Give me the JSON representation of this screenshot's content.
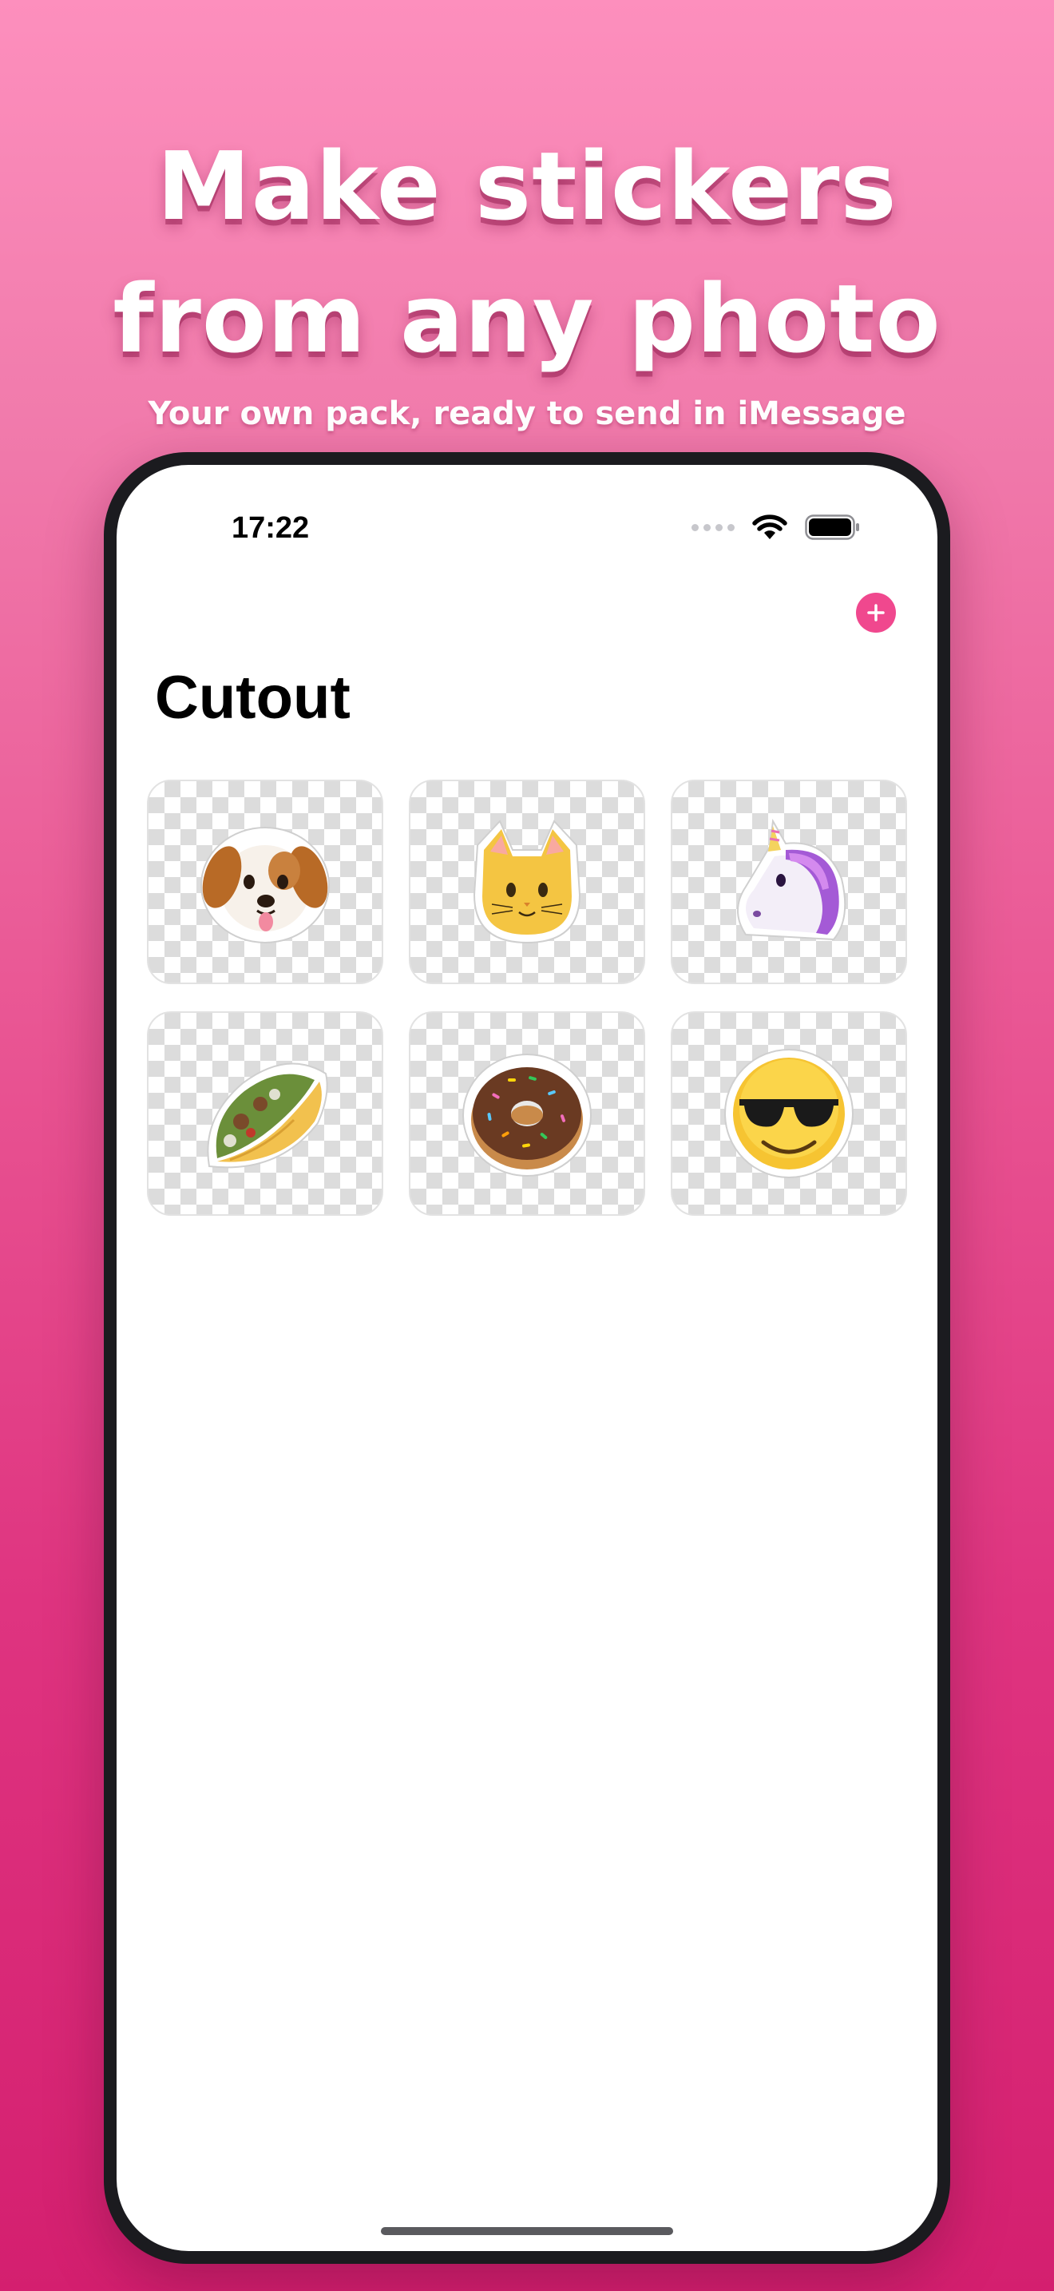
{
  "promo": {
    "headline_line1": "Make stickers",
    "headline_line2": "from any photo",
    "subheadline": "Your own pack, ready to send in iMessage"
  },
  "status_bar": {
    "time": "17:22",
    "icons": [
      "cellular-signal-icon",
      "wifi-icon",
      "battery-icon"
    ]
  },
  "nav": {
    "title": "Cutout",
    "add_icon": "plus-icon",
    "accent_color": "#f0488e"
  },
  "stickers": [
    {
      "name": "dog-face-sticker"
    },
    {
      "name": "cat-face-sticker"
    },
    {
      "name": "unicorn-sticker"
    },
    {
      "name": "taco-sticker"
    },
    {
      "name": "donut-sticker"
    },
    {
      "name": "sunglasses-face-sticker"
    }
  ],
  "colors": {
    "background_top": "#fd8fbd",
    "background_bottom": "#d41f6f",
    "phone_frame": "#1b1b1f"
  }
}
